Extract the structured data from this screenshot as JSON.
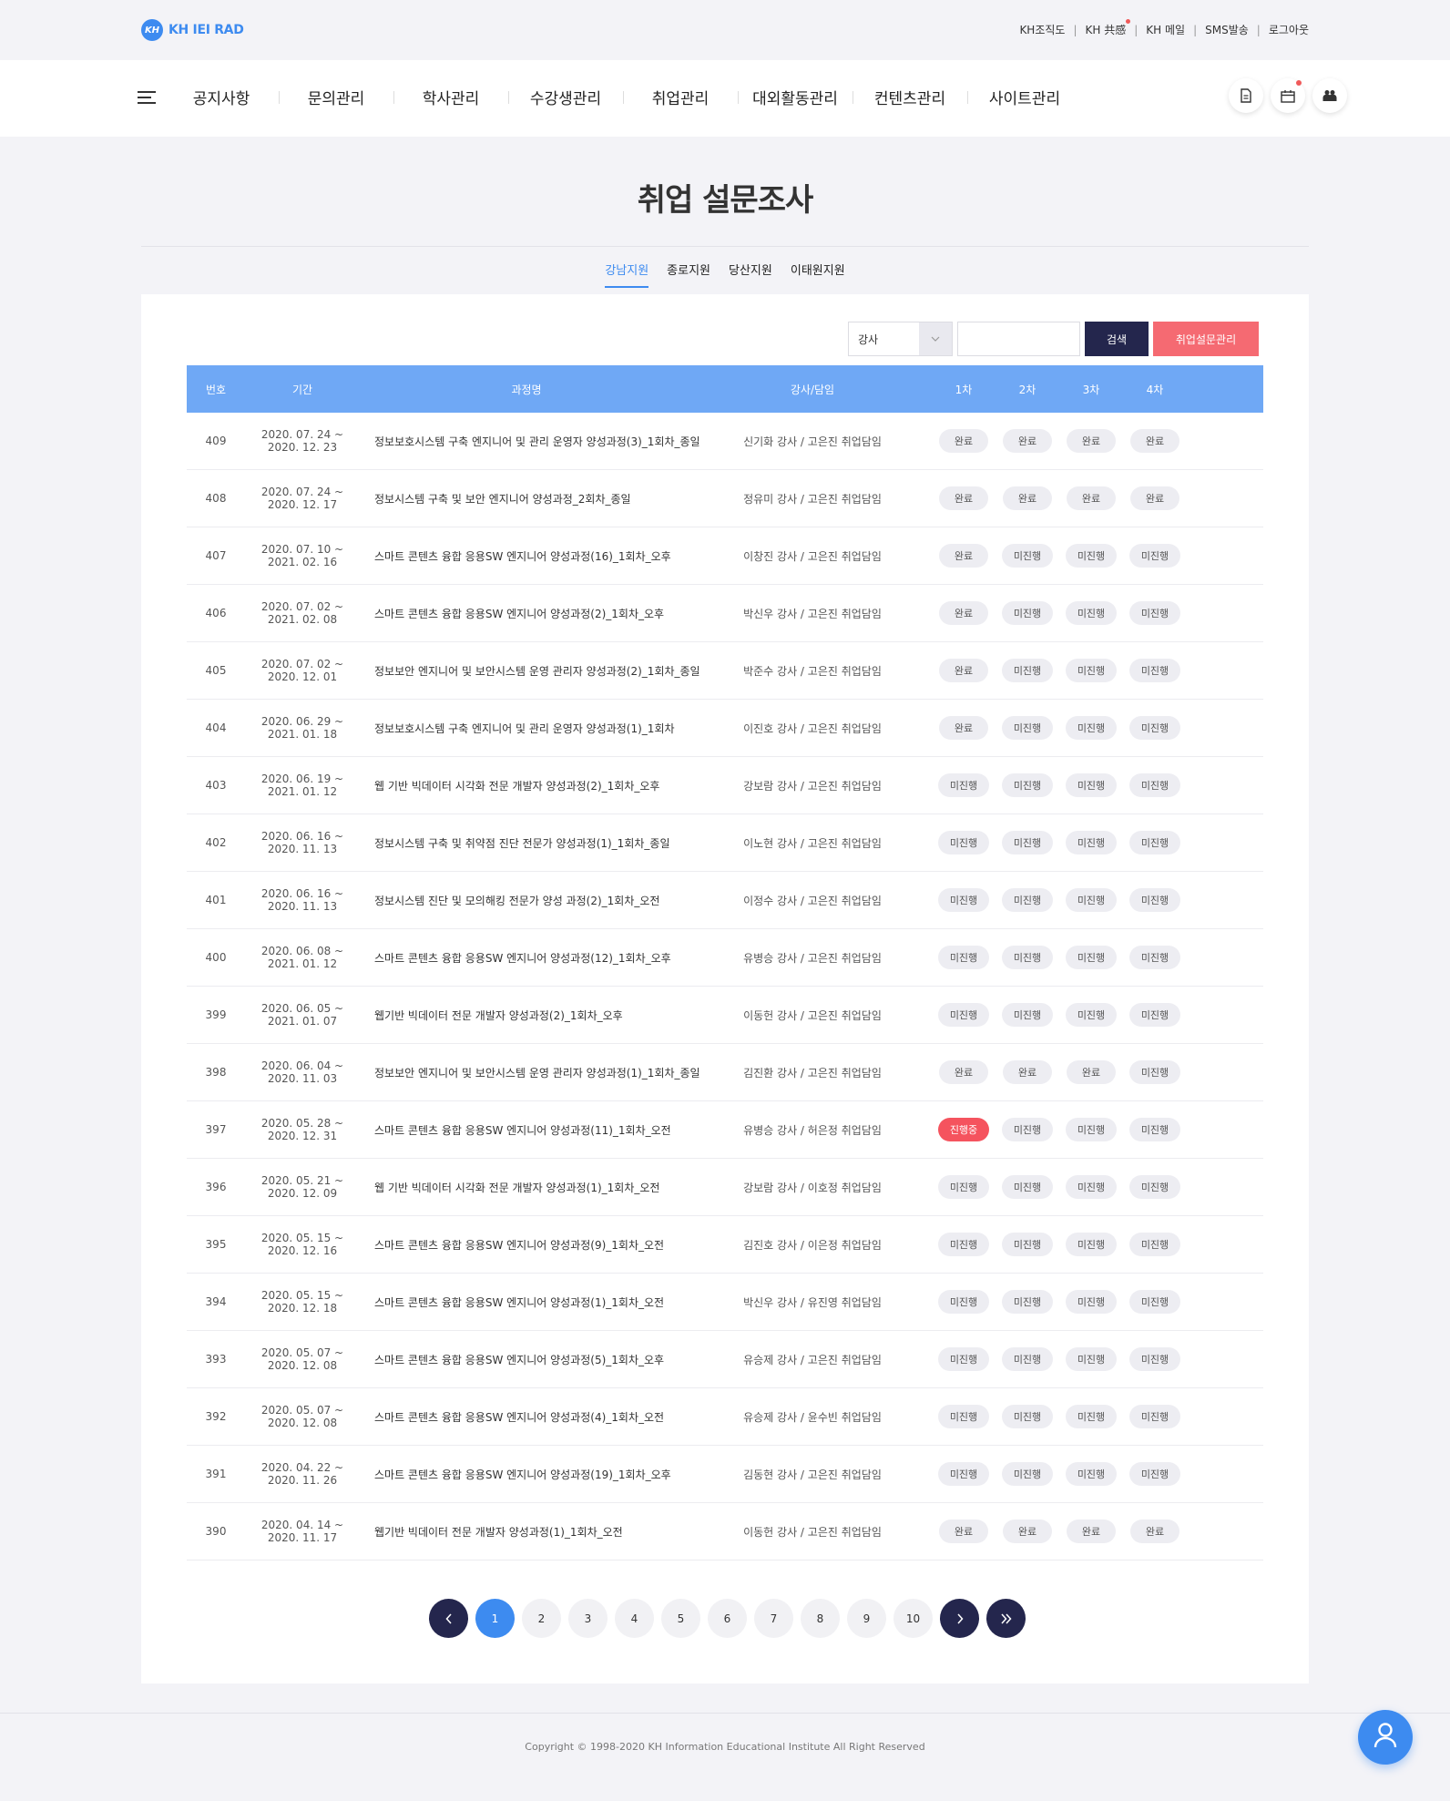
{
  "header": {
    "logo_mark": "KH",
    "logo_text": "KH IEI RAD",
    "util_links": [
      "KH조직도",
      "KH 共感",
      "KH 메일",
      "SMS발송",
      "로그아웃"
    ]
  },
  "nav": {
    "menu": [
      "공지사항",
      "문의관리",
      "학사관리",
      "수강생관리",
      "취업관리",
      "대외활동관리",
      "컨텐츠관리",
      "사이트관리"
    ],
    "icons": [
      "document-icon",
      "calendar-icon",
      "people-icon"
    ]
  },
  "page": {
    "title": "취업 설문조사",
    "tabs": [
      "강남지원",
      "종로지원",
      "당산지원",
      "이태원지원"
    ],
    "active_tab": 0
  },
  "search": {
    "select_value": "강사",
    "input_value": "",
    "search_label": "검색",
    "manage_label": "취업설문관리"
  },
  "table": {
    "headers": [
      "번호",
      "기간",
      "과정명",
      "강사/담임",
      "1차",
      "2차",
      "3차",
      "4차"
    ],
    "rows": [
      {
        "no": "409",
        "period": "2020. 07. 24 ~ 2020. 12. 23",
        "course": "정보보호시스템 구축 엔지니어 및 관리 운영자 양성과정(3)_1회차_종일",
        "teacher": "신기화 강사 / 고은진 취업담임",
        "status": [
          "완료",
          "완료",
          "완료",
          "완료"
        ]
      },
      {
        "no": "408",
        "period": "2020. 07. 24 ~ 2020. 12. 17",
        "course": "정보시스템 구축 및 보안 엔지니어 양성과정_2회차_종일",
        "teacher": "정유미 강사 / 고은진 취업담임",
        "status": [
          "완료",
          "완료",
          "완료",
          "완료"
        ]
      },
      {
        "no": "407",
        "period": "2020. 07. 10 ~ 2021. 02. 16",
        "course": "스마트 콘텐츠 융합 응용SW 엔지니어 양성과정(16)_1회차_오후",
        "teacher": "이창진 강사 / 고은진 취업담임",
        "status": [
          "완료",
          "미진행",
          "미진행",
          "미진행"
        ]
      },
      {
        "no": "406",
        "period": "2020. 07. 02 ~ 2021. 02. 08",
        "course": "스마트 콘텐츠 융합 응용SW 엔지니어 양성과정(2)_1회차_오후",
        "teacher": "박신우 강사 / 고은진 취업담임",
        "status": [
          "완료",
          "미진행",
          "미진행",
          "미진행"
        ]
      },
      {
        "no": "405",
        "period": "2020. 07. 02 ~ 2020. 12. 01",
        "course": "정보보안 엔지니어 및 보안시스템 운영 관리자 양성과정(2)_1회차_종일",
        "teacher": "박준수 강사 / 고은진 취업담임",
        "status": [
          "완료",
          "미진행",
          "미진행",
          "미진행"
        ]
      },
      {
        "no": "404",
        "period": "2020. 06. 29 ~ 2021. 01. 18",
        "course": "정보보호시스템 구축 엔지니어 및 관리 운영자 양성과정(1)_1회차",
        "teacher": "이진호 강사 / 고은진 취업담임",
        "status": [
          "완료",
          "미진행",
          "미진행",
          "미진행"
        ]
      },
      {
        "no": "403",
        "period": "2020. 06. 19 ~ 2021. 01. 12",
        "course": "웹 기반 빅데이터 시각화 전문 개발자 양성과정(2)_1회차_오후",
        "teacher": "강보람 강사 / 고은진 취업담임",
        "status": [
          "미진행",
          "미진행",
          "미진행",
          "미진행"
        ]
      },
      {
        "no": "402",
        "period": "2020. 06. 16 ~ 2020. 11. 13",
        "course": "정보시스템 구축 및 취약점 진단 전문가 양성과정(1)_1회차_종일",
        "teacher": "이노현 강사 / 고은진 취업담임",
        "status": [
          "미진행",
          "미진행",
          "미진행",
          "미진행"
        ]
      },
      {
        "no": "401",
        "period": "2020. 06. 16 ~ 2020. 11. 13",
        "course": "정보시스템 진단 및 모의해킹 전문가 양성 과정(2)_1회차_오전",
        "teacher": "이정수 강사 / 고은진 취업담임",
        "status": [
          "미진행",
          "미진행",
          "미진행",
          "미진행"
        ]
      },
      {
        "no": "400",
        "period": "2020. 06. 08 ~ 2021. 01. 12",
        "course": "스마트 콘텐츠 융합 응용SW 엔지니어 양성과정(12)_1회차_오후",
        "teacher": "유병승 강사 / 고은진 취업담임",
        "status": [
          "미진행",
          "미진행",
          "미진행",
          "미진행"
        ]
      },
      {
        "no": "399",
        "period": "2020. 06. 05 ~ 2021. 01. 07",
        "course": "웹기반 빅데이터 전문 개발자 양성과정(2)_1회차_오후",
        "teacher": "이동헌 강사 / 고은진 취업담임",
        "status": [
          "미진행",
          "미진행",
          "미진행",
          "미진행"
        ]
      },
      {
        "no": "398",
        "period": "2020. 06. 04 ~ 2020. 11. 03",
        "course": "정보보안 엔지니어 및 보안시스템 운영 관리자 양성과정(1)_1회차_종일",
        "teacher": "김진환 강사 / 고은진 취업담임",
        "status": [
          "완료",
          "완료",
          "완료",
          "미진행"
        ]
      },
      {
        "no": "397",
        "period": "2020. 05. 28 ~ 2020. 12. 31",
        "course": "스마트 콘텐츠 융합 응용SW 엔지니어 양성과정(11)_1회차_오전",
        "teacher": "유병승 강사 / 허은정 취업담임",
        "status": [
          "진행중",
          "미진행",
          "미진행",
          "미진행"
        ]
      },
      {
        "no": "396",
        "period": "2020. 05. 21 ~ 2020. 12. 09",
        "course": "웹 기반 빅데이터 시각화 전문 개발자 양성과정(1)_1회차_오전",
        "teacher": "강보람 강사 / 이호정 취업담임",
        "status": [
          "미진행",
          "미진행",
          "미진행",
          "미진행"
        ]
      },
      {
        "no": "395",
        "period": "2020. 05. 15 ~ 2020. 12. 16",
        "course": "스마트 콘텐츠 융합 응용SW 엔지니어 양성과정(9)_1회차_오전",
        "teacher": "김진호 강사 / 이은정 취업담임",
        "status": [
          "미진행",
          "미진행",
          "미진행",
          "미진행"
        ]
      },
      {
        "no": "394",
        "period": "2020. 05. 15 ~ 2020. 12. 18",
        "course": "스마트 콘텐츠 융합 응용SW 엔지니어 양성과정(1)_1회차_오전",
        "teacher": "박신우 강사 / 유진영 취업담임",
        "status": [
          "미진행",
          "미진행",
          "미진행",
          "미진행"
        ]
      },
      {
        "no": "393",
        "period": "2020. 05. 07 ~ 2020. 12. 08",
        "course": "스마트 콘텐츠 융합 응용SW 엔지니어 양성과정(5)_1회차_오후",
        "teacher": "유승제 강사 / 고은진 취업담임",
        "status": [
          "미진행",
          "미진행",
          "미진행",
          "미진행"
        ]
      },
      {
        "no": "392",
        "period": "2020. 05. 07 ~ 2020. 12. 08",
        "course": "스마트 콘텐츠 융합 응용SW 엔지니어 양성과정(4)_1회차_오전",
        "teacher": "유승제 강사 / 윤수빈 취업담임",
        "status": [
          "미진행",
          "미진행",
          "미진행",
          "미진행"
        ]
      },
      {
        "no": "391",
        "period": "2020. 04. 22 ~ 2020. 11. 26",
        "course": "스마트 콘텐츠 융합 응용SW 엔지니어 양성과정(19)_1회차_오후",
        "teacher": "김동현 강사 / 고은진 취업담임",
        "status": [
          "미진행",
          "미진행",
          "미진행",
          "미진행"
        ]
      },
      {
        "no": "390",
        "period": "2020. 04. 14 ~ 2020. 11. 17",
        "course": "웹기반 빅데이터 전문 개발자 양성과정(1)_1회차_오전",
        "teacher": "이동헌 강사 / 고은진 취업담임",
        "status": [
          "완료",
          "완료",
          "완료",
          "완료"
        ]
      }
    ]
  },
  "pagination": {
    "pages": [
      "1",
      "2",
      "3",
      "4",
      "5",
      "6",
      "7",
      "8",
      "9",
      "10"
    ],
    "current": "1"
  },
  "footer": {
    "copyright": "Copyright © 1998-2020 KH Information Educational Institute All Right Reserved"
  },
  "colors": {
    "accent": "#3d8bf0",
    "header_row": "#6fa8f5",
    "dark_button": "#24264d",
    "danger_button": "#f56a72",
    "active_badge": "#f5535e"
  }
}
